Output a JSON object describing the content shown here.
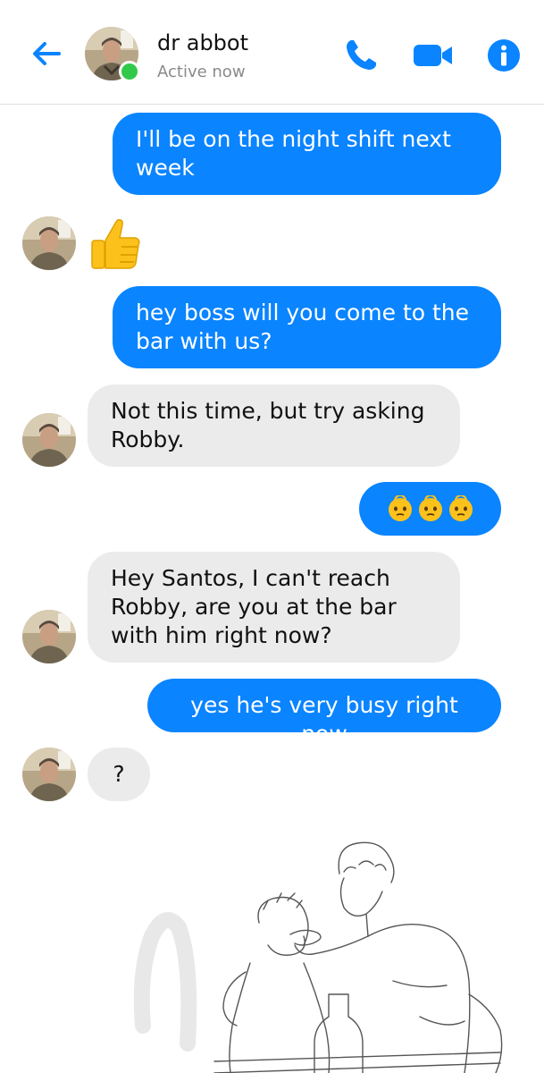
{
  "header": {
    "contact_name": "dr abbot",
    "status": "Active now",
    "colors": {
      "accent": "#0a84ff",
      "online": "#31c94a"
    },
    "icons": [
      "back-arrow-icon",
      "phone-icon",
      "video-camera-icon",
      "info-icon"
    ]
  },
  "messages": [
    {
      "side": "outgoing",
      "text": "I'll be on the night shift next week"
    },
    {
      "side": "incoming",
      "emoji": "thumbs-up"
    },
    {
      "side": "outgoing",
      "text": "hey boss will you come to the bar with us?"
    },
    {
      "side": "incoming",
      "text": "Not this time, but try asking Robby."
    },
    {
      "side": "outgoing",
      "emoji": "dizzy-face-x3"
    },
    {
      "side": "incoming",
      "text": "Hey Santos, I can't reach Robby, are you at the bar with him right now?"
    },
    {
      "side": "outgoing",
      "text": "yes he's very busy right now"
    },
    {
      "side": "incoming",
      "text": "?"
    }
  ],
  "colors": {
    "outgoing_bubble": "#0a84ff",
    "incoming_bubble": "#ebebeb"
  }
}
